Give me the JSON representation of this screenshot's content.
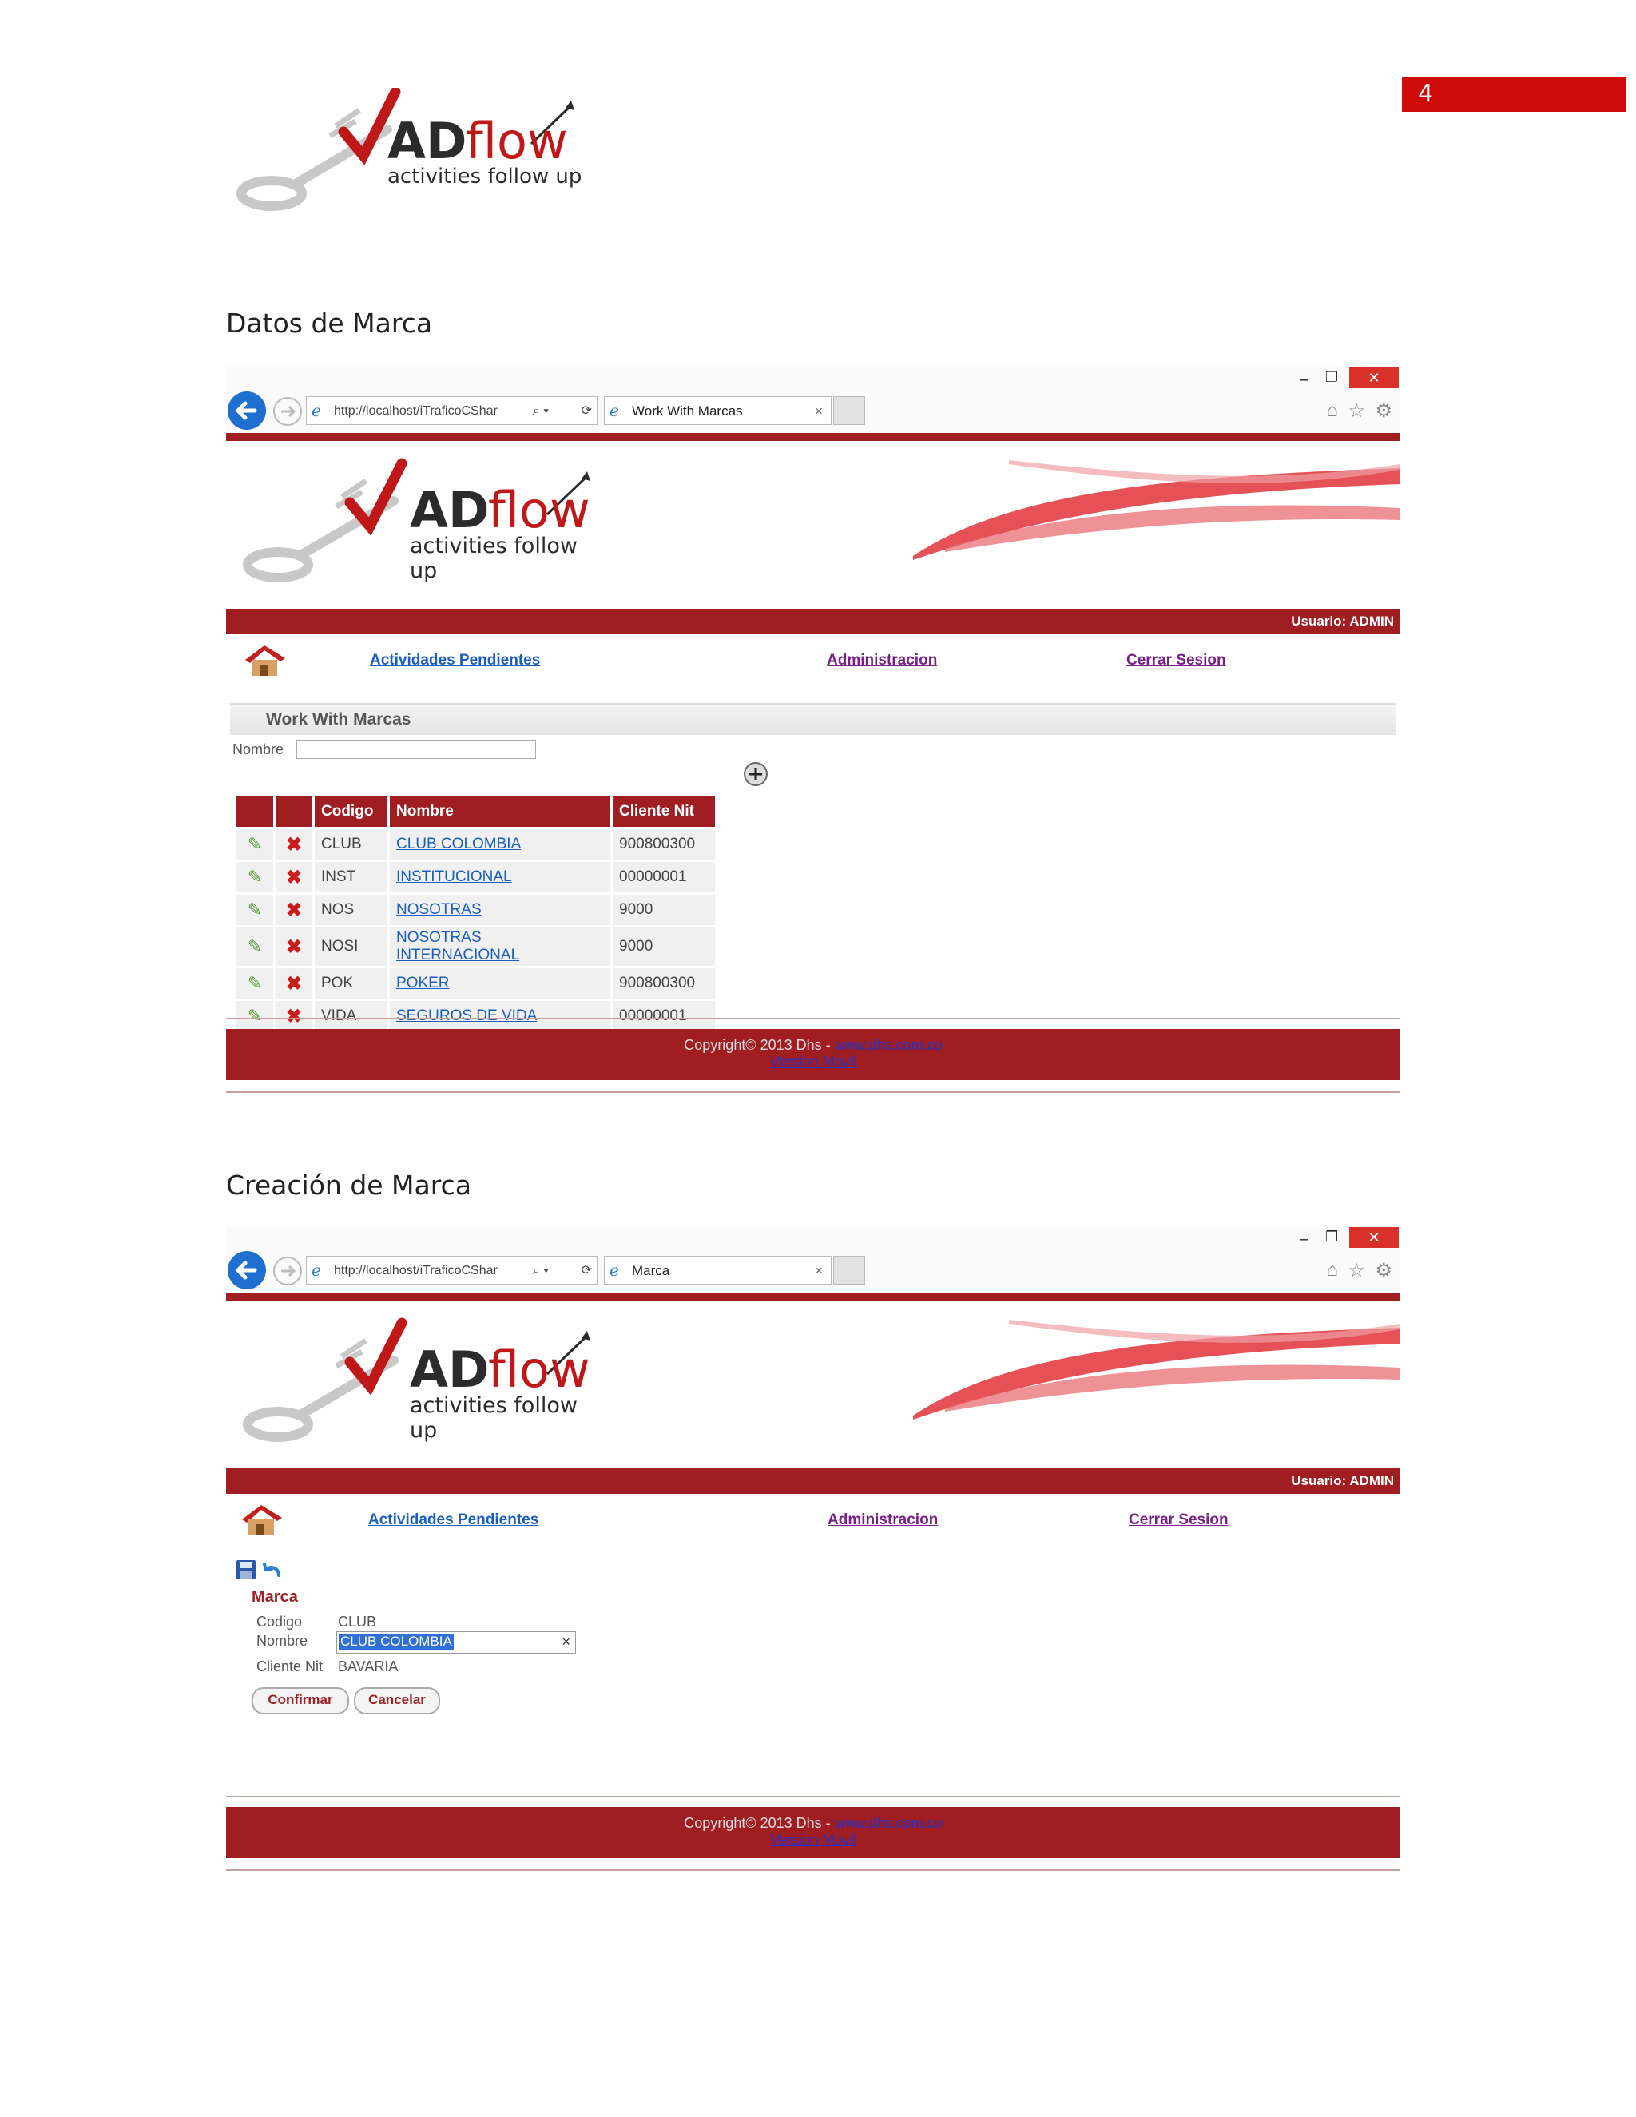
{
  "page_number": "4",
  "logo": {
    "ad": "AD",
    "flow": "flow",
    "tagline": "activities follow up"
  },
  "section1_heading": "Datos de Marca",
  "section2_heading": "Creación de Marca",
  "browser1": {
    "url": "http://localhost/iTraficoCShar",
    "tab_title": "Work With Marcas",
    "close": "×"
  },
  "browser2": {
    "url": "http://localhost/iTraficoCShar",
    "tab_title": "Marca",
    "close": "×"
  },
  "user_label": "Usuario: ADMIN",
  "nav": {
    "pending": "Actividades Pendientes",
    "admin": "Administracion",
    "logout": "Cerrar Sesion"
  },
  "work_with": {
    "title": "Work With Marcas",
    "filter_label": "Nombre",
    "filter_value": "",
    "columns": [
      "Codigo",
      "Nombre",
      "Cliente Nit"
    ],
    "rows": [
      {
        "codigo": "CLUB",
        "nombre": "CLUB COLOMBIA",
        "nit": "900800300"
      },
      {
        "codigo": "INST",
        "nombre": "INSTITUCIONAL",
        "nit": "00000001"
      },
      {
        "codigo": "NOS",
        "nombre": "NOSOTRAS",
        "nit": "9000"
      },
      {
        "codigo": "NOSI",
        "nombre": "NOSOTRAS INTERNACIONAL",
        "nit": "9000"
      },
      {
        "codigo": "POK",
        "nombre": "POKER",
        "nit": "900800300"
      },
      {
        "codigo": "VIDA",
        "nombre": "SEGUROS DE VIDA",
        "nit": "00000001"
      }
    ]
  },
  "footer": {
    "copyright": "Copyright© 2013 Dhs - ",
    "site": "www.dhs.com.co",
    "version": "Version Movil"
  },
  "form": {
    "title": "Marca",
    "codigo_label": "Codigo",
    "codigo_value": "CLUB",
    "nombre_label": "Nombre",
    "nombre_value": "CLUB COLOMBIA",
    "nit_label": "Cliente Nit",
    "nit_value": "BAVARIA",
    "confirm": "Confirmar",
    "cancel": "Cancelar"
  },
  "colors": {
    "brand_red": "#a01e22",
    "page_number_red": "#cf0a0a",
    "link_blue": "#1a5fbf",
    "link_purple": "#7a1f8a"
  }
}
